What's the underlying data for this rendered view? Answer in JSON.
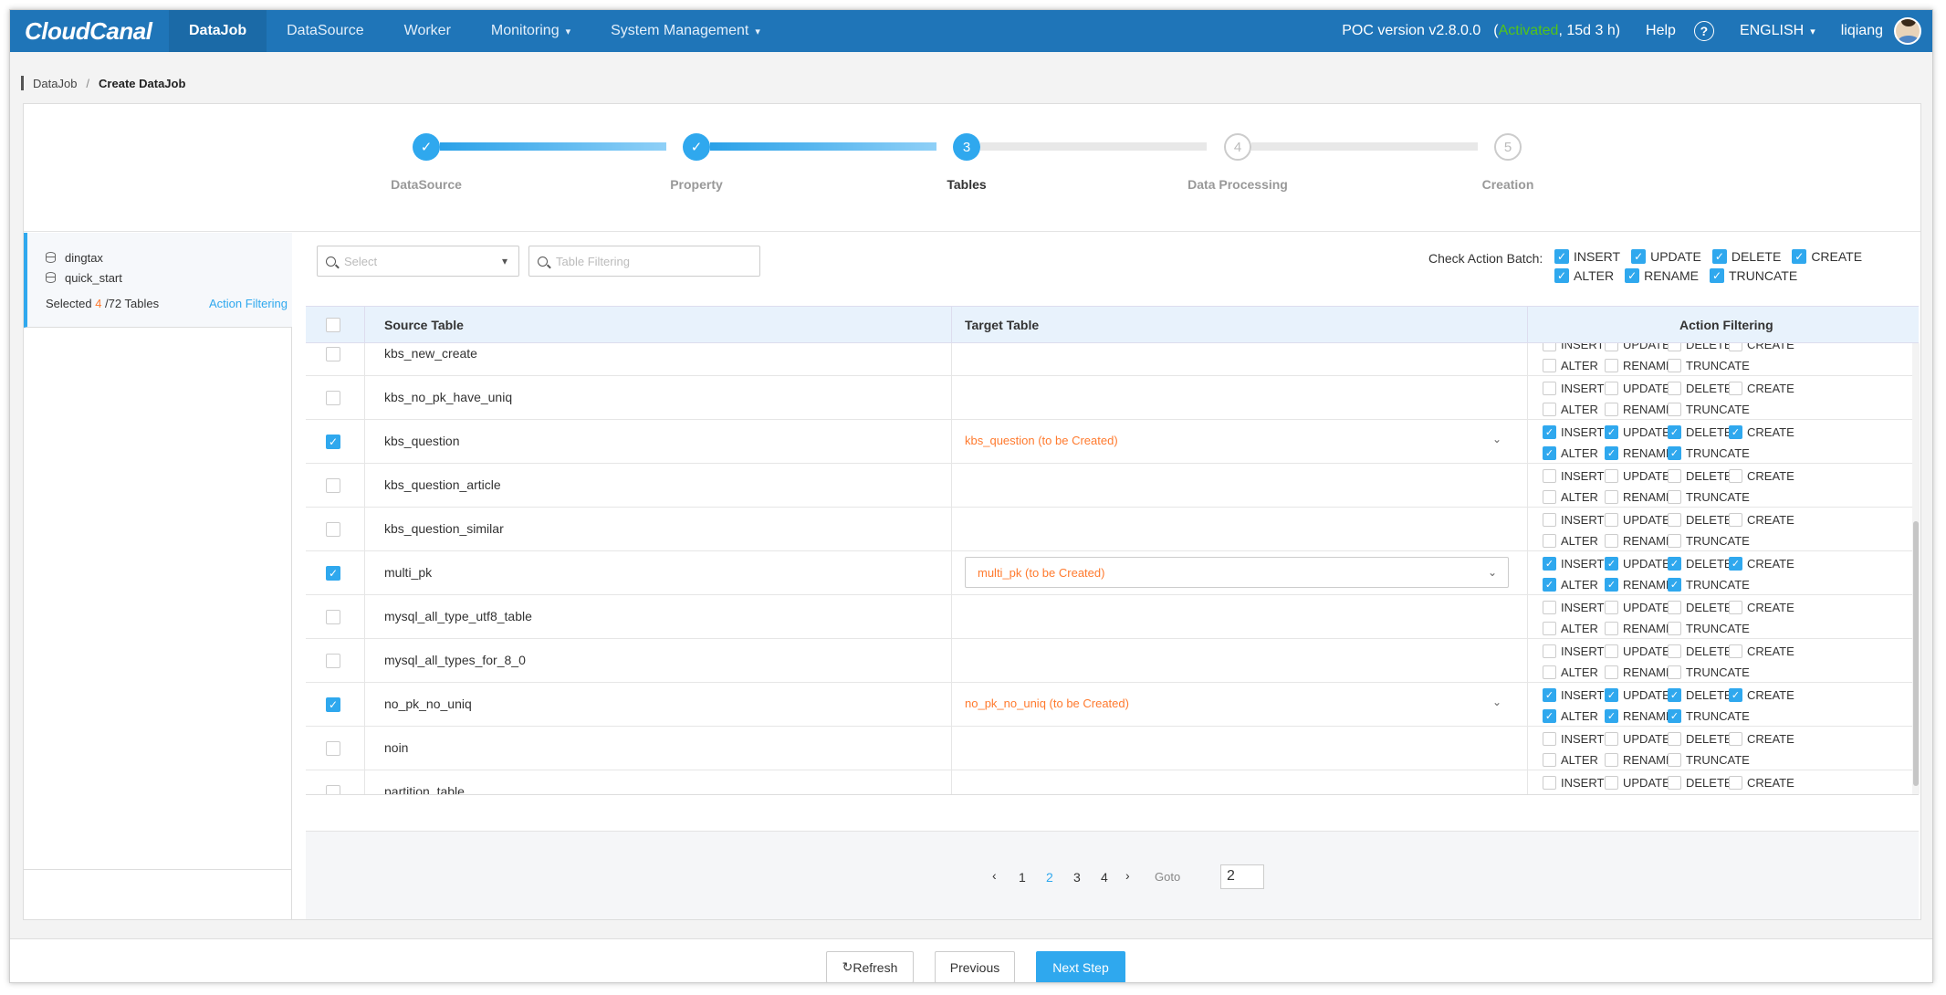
{
  "app": {
    "logo": "CloudCanal"
  },
  "nav": {
    "items": [
      {
        "label": "DataJob",
        "active": true
      },
      {
        "label": "DataSource"
      },
      {
        "label": "Worker"
      },
      {
        "label": "Monitoring",
        "dropdown": true
      },
      {
        "label": "System Management",
        "dropdown": true
      }
    ],
    "version": "POC version v2.8.0.0",
    "license_open": "(",
    "license_status": "Activated",
    "license_remaining": ", 15d 3 h)",
    "help": "Help",
    "help_icon": "?",
    "language": "ENGLISH",
    "user": "liqiang"
  },
  "breadcrumb": {
    "root": "DataJob",
    "sep": "/",
    "current": "Create DataJob"
  },
  "steps": [
    {
      "label": "DataSource",
      "status": "done",
      "num": "✓"
    },
    {
      "label": "Property",
      "status": "done",
      "num": "✓"
    },
    {
      "label": "Tables",
      "status": "current",
      "num": "3"
    },
    {
      "label": "Data Processing",
      "status": "todo",
      "num": "4"
    },
    {
      "label": "Creation",
      "status": "todo",
      "num": "5"
    }
  ],
  "left": {
    "databases": [
      "dingtax",
      "quick_start"
    ],
    "selected_prefix": "Selected ",
    "selected_count": "4",
    "selected_suffix": " /72 Tables",
    "action_filtering": "Action Filtering"
  },
  "toolbar": {
    "select_placeholder": "Select",
    "filter_placeholder": "Table Filtering",
    "batch_label": "Check Action Batch:",
    "batch_row1": [
      "INSERT",
      "UPDATE",
      "DELETE",
      "CREATE"
    ],
    "batch_row2": [
      "ALTER",
      "RENAME",
      "TRUNCATE"
    ]
  },
  "table": {
    "headers": {
      "source": "Source Table",
      "target": "Target Table",
      "action": "Action Filtering"
    },
    "actions_row1": [
      "INSERT",
      "UPDATE",
      "DELETE",
      "CREATE"
    ],
    "actions_row2": [
      "ALTER",
      "RENAME",
      "TRUNCATE"
    ],
    "rows": [
      {
        "name": "kbs_new_create",
        "checked": false,
        "target": ""
      },
      {
        "name": "kbs_no_pk_have_uniq",
        "checked": false,
        "target": ""
      },
      {
        "name": "kbs_question",
        "checked": true,
        "target": "kbs_question (to be Created)"
      },
      {
        "name": "kbs_question_article",
        "checked": false,
        "target": ""
      },
      {
        "name": "kbs_question_similar",
        "checked": false,
        "target": ""
      },
      {
        "name": "multi_pk",
        "checked": true,
        "target": "multi_pk (to be Created)",
        "boxed": true
      },
      {
        "name": "mysql_all_type_utf8_table",
        "checked": false,
        "target": ""
      },
      {
        "name": "mysql_all_types_for_8_0",
        "checked": false,
        "target": ""
      },
      {
        "name": "no_pk_no_uniq",
        "checked": true,
        "target": "no_pk_no_uniq (to be Created)"
      },
      {
        "name": "noin",
        "checked": false,
        "target": ""
      },
      {
        "name": "partition_table",
        "checked": false,
        "target": ""
      }
    ]
  },
  "pager": {
    "prev": "‹",
    "pages": [
      "1",
      "2",
      "3",
      "4"
    ],
    "current": "2",
    "next": "›",
    "goto_label": "Goto",
    "goto_value": "2"
  },
  "footer": {
    "refresh": "Refresh",
    "refresh_icon": "↻",
    "previous": "Previous",
    "next": "Next Step"
  },
  "colors": {
    "nav": "#1f75b8",
    "accent": "#2fa8ee",
    "orange": "#ff7a2e",
    "activated": "#52c41a"
  }
}
